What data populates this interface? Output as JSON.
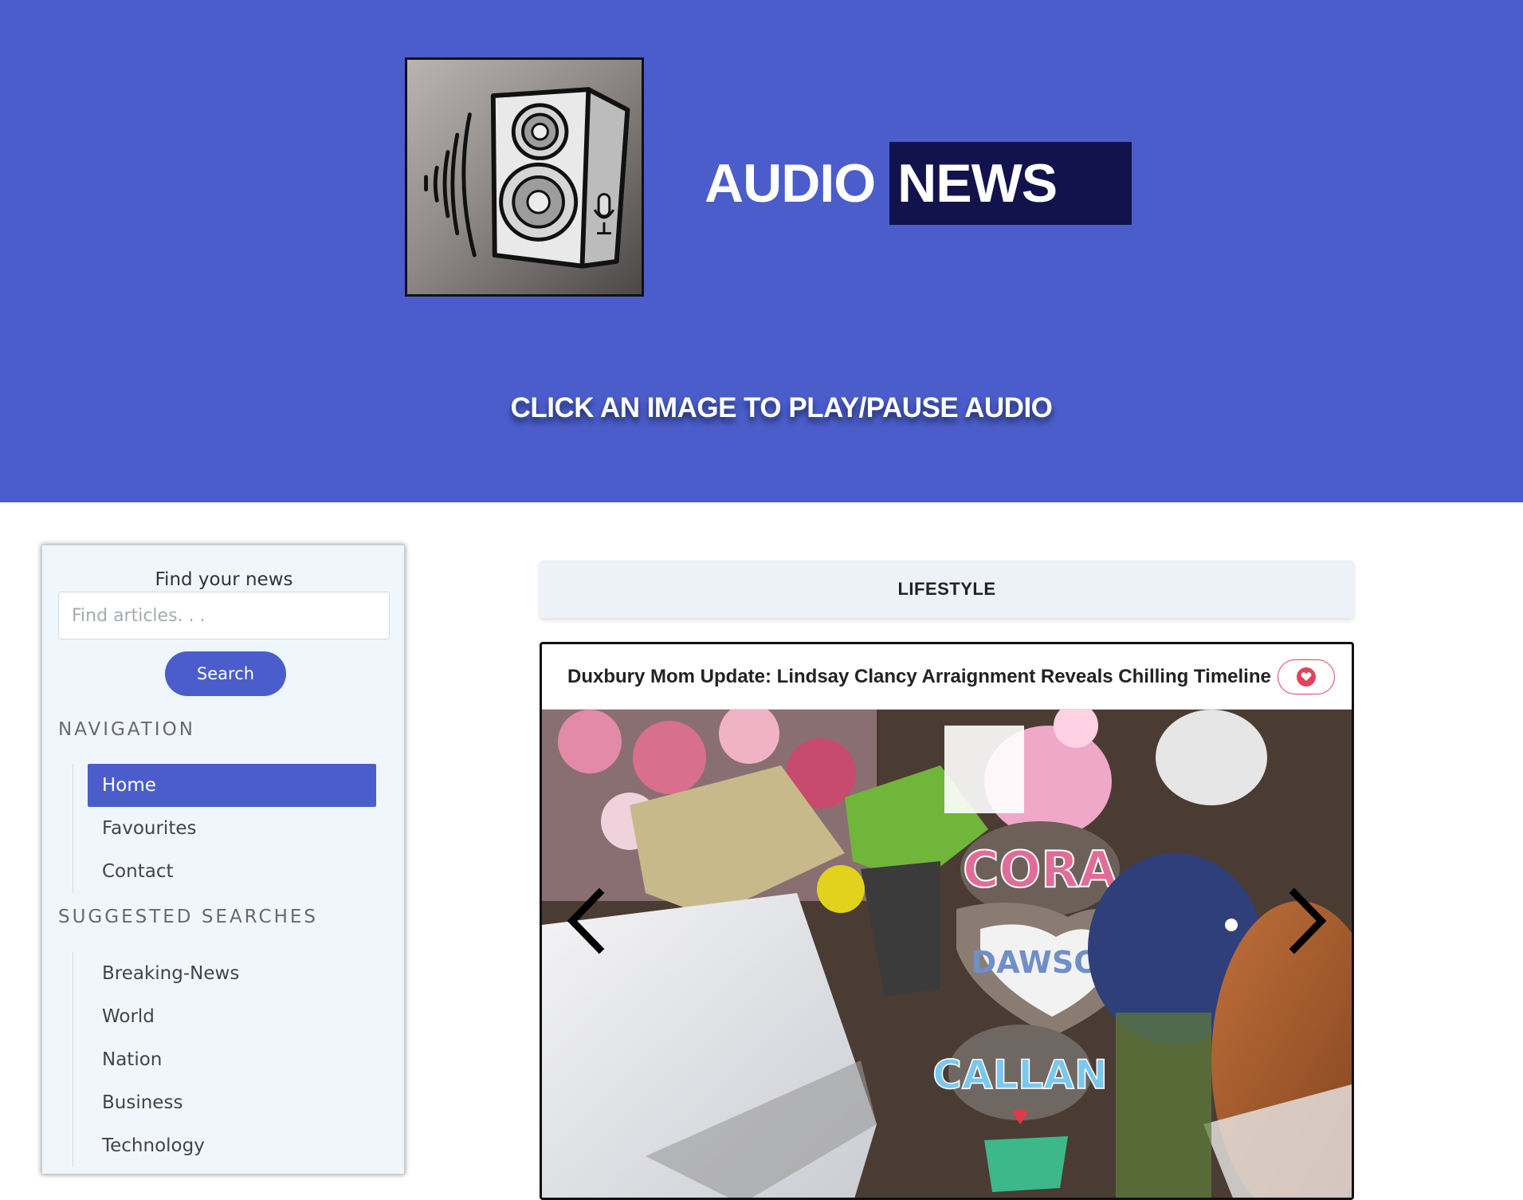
{
  "header": {
    "brand_part1": "AUDIO",
    "brand_part2": "NEWS",
    "tagline": "CLICK AN IMAGE TO PLAY/PAUSE AUDIO",
    "logo_icon": "speaker-icon"
  },
  "sidebar": {
    "search_label": "Find your news",
    "search_placeholder": "Find articles. . .",
    "search_button": "Search",
    "nav_title": "NAVIGATION",
    "nav_items": [
      {
        "label": "Home",
        "active": true
      },
      {
        "label": "Favourites",
        "active": false
      },
      {
        "label": "Contact",
        "active": false
      }
    ],
    "suggested_title": "SUGGESTED SEARCHES",
    "suggested_items": [
      {
        "label": "Breaking-News"
      },
      {
        "label": "World"
      },
      {
        "label": "Nation"
      },
      {
        "label": "Business"
      },
      {
        "label": "Technology"
      }
    ]
  },
  "main": {
    "category": "LIFESTYLE",
    "article": {
      "title": "Duxbury Mom Update: Lindsay Clancy Arraignment Reveals Chilling Timeline",
      "favourite_icon": "heart-icon",
      "image_stone_labels": [
        "CORA",
        "DAWSON",
        "CALLAN"
      ]
    }
  },
  "colors": {
    "primary": "#4a5dcb",
    "brand_dark": "#12124c",
    "sidebar_bg": "#eff7fd",
    "favourite": "#e0435a"
  }
}
